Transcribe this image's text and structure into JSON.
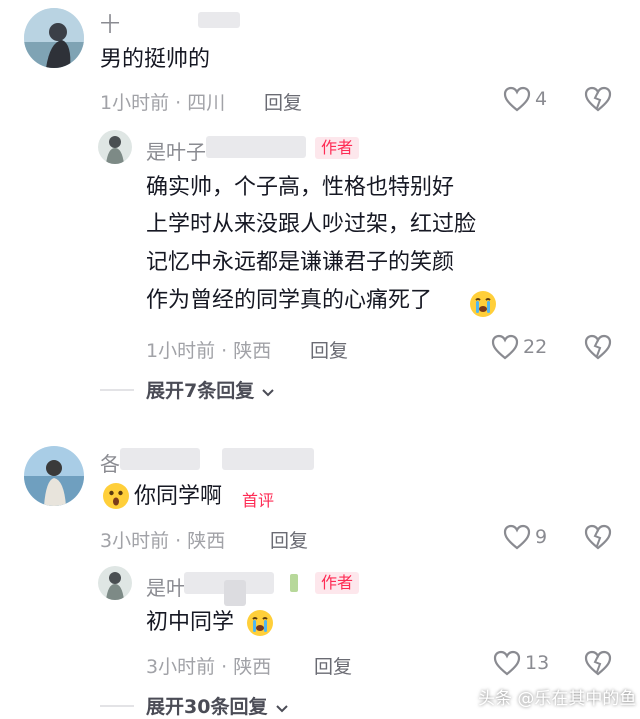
{
  "comments": [
    {
      "name_hint": "十",
      "text": "男的挺帅的",
      "time": "1小时前 · 四川",
      "reply_label": "回复",
      "likes": "4",
      "replies": [
        {
          "name_hint": "是叶子",
          "tag": "作者",
          "lines": [
            "确实帅，个子高，性格也特别好",
            "上学时从来没跟人吵过架，红过脸",
            "记忆中永远都是谦谦君子的笑颜",
            "作为曾经的同学真的心痛死了"
          ],
          "time": "1小时前 · 陕西",
          "reply_label": "回复",
          "likes": "22"
        }
      ],
      "expand_label": "展开7条回复"
    },
    {
      "name_hint": "各",
      "text": "你同学啊",
      "tag": "首评",
      "time": "3小时前 · 陕西",
      "reply_label": "回复",
      "likes": "9",
      "replies": [
        {
          "name_hint": "是叶",
          "tag": "作者",
          "text": "初中同学",
          "time": "3小时前 · 陕西",
          "reply_label": "回复",
          "likes": "13"
        }
      ],
      "expand_label": "展开30条回复"
    }
  ],
  "watermark": "头条 @乐在其中的鱼",
  "icons": {
    "like": "heart-outline-icon",
    "dislike": "broken-heart-icon",
    "expand": "chevron-down-icon",
    "crying": "crying-emoji-icon",
    "shocked": "shocked-emoji-icon"
  },
  "colors": {
    "accent": "#fe2c55",
    "tag_bg": "#fde7ec",
    "meta": "#a1a2a7"
  }
}
